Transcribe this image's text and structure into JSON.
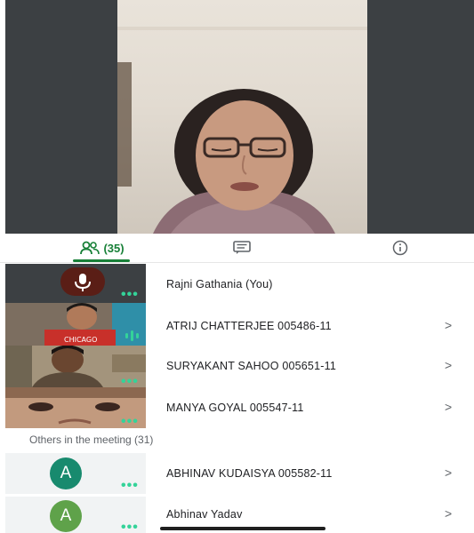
{
  "tabs": {
    "people_count": "(35)",
    "people_icon": "people-icon",
    "chat_icon": "chat-icon",
    "info_icon": "info-icon"
  },
  "participants": [
    {
      "name": "Rajni Gathania (You)",
      "thumb": "muted-tile"
    },
    {
      "name": "ATRIJ CHATTERJEE 005486-11",
      "chevron": ">"
    },
    {
      "name": "SURYAKANT SAHOO 005651-11",
      "chevron": ">"
    },
    {
      "name": "MANYA GOYAL 005547-11",
      "chevron": ">"
    }
  ],
  "others": {
    "label": "Others in the meeting (31)",
    "items": [
      {
        "name": "ABHINAV KUDAISYA 005582-11",
        "initial": "A",
        "color": "#188a6e",
        "chevron": ">"
      },
      {
        "name": "Abhinav Yadav",
        "initial": "A",
        "color": "#5fa24a",
        "chevron": ">"
      }
    ]
  },
  "colors": {
    "accent": "#188038",
    "tile_bg": "#3c4043",
    "speaking_indicator": "#34d399"
  },
  "dots": "•••"
}
